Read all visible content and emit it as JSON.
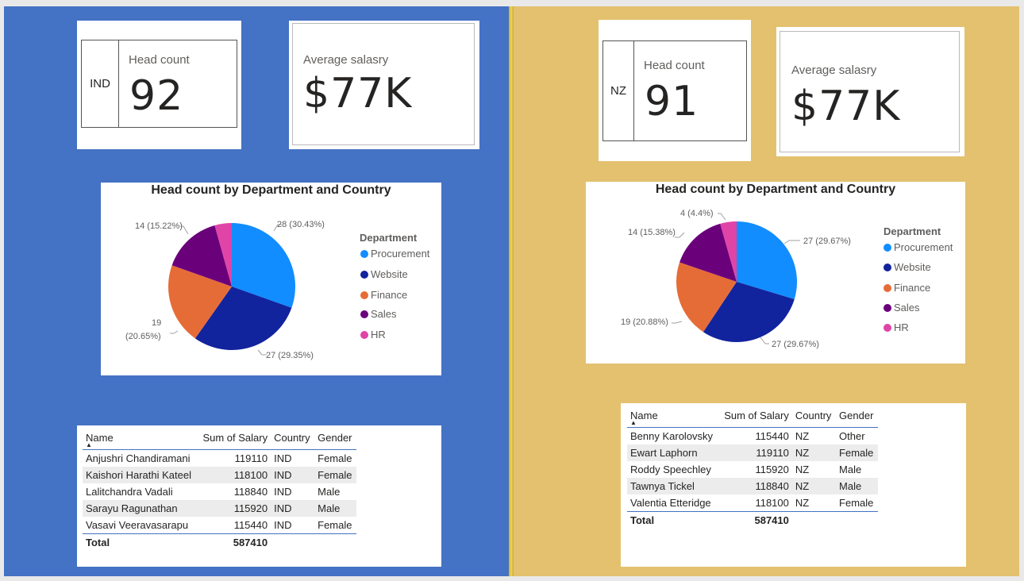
{
  "panels": {
    "ind": {
      "country_code": "IND",
      "head_count_label": "Head count",
      "head_count_value": "92",
      "avg_salary_label": "Average salasry",
      "avg_salary_value": "$77K",
      "chart": {
        "title": "Head count by Department and Country",
        "legend_title": "Department",
        "legend": [
          "Procurement",
          "Website",
          "Finance",
          "Sales",
          "HR"
        ],
        "slice_labels": [
          "28 (30.43%)",
          "27 (29.35%)",
          "19",
          "(20.65%)",
          "14 (15.22%)"
        ]
      },
      "table": {
        "headers": [
          "Name",
          "Sum of Salary",
          "Country",
          "Gender"
        ],
        "rows": [
          [
            "Anjushri Chandiramani",
            "119110",
            "IND",
            "Female"
          ],
          [
            "Kaishori Harathi Kateel",
            "118100",
            "IND",
            "Female"
          ],
          [
            "Lalitchandra Vadali",
            "118840",
            "IND",
            "Male"
          ],
          [
            "Sarayu Ragunathan",
            "115920",
            "IND",
            "Male"
          ],
          [
            "Vasavi Veeravasarapu",
            "115440",
            "IND",
            "Female"
          ]
        ],
        "total_label": "Total",
        "total_value": "587410"
      }
    },
    "nz": {
      "country_code": "NZ",
      "head_count_label": "Head count",
      "head_count_value": "91",
      "avg_salary_label": "Average salasry",
      "avg_salary_value": "$77K",
      "chart": {
        "title": "Head count by Department and Country",
        "legend_title": "Department",
        "legend": [
          "Procurement",
          "Website",
          "Finance",
          "Sales",
          "HR"
        ],
        "slice_labels": [
          "27 (29.67%)",
          "27 (29.67%)",
          "19 (20.88%)",
          "14 (15.38%)",
          "4 (4.4%)"
        ]
      },
      "table": {
        "headers": [
          "Name",
          "Sum of Salary",
          "Country",
          "Gender"
        ],
        "rows": [
          [
            "Benny Karolovsky",
            "115440",
            "NZ",
            "Other"
          ],
          [
            "Ewart Laphorn",
            "119110",
            "NZ",
            "Female"
          ],
          [
            "Roddy Speechley",
            "115920",
            "NZ",
            "Male"
          ],
          [
            "Tawnya Tickel",
            "118840",
            "NZ",
            "Male"
          ],
          [
            "Valentia Etteridge",
            "118100",
            "NZ",
            "Female"
          ]
        ],
        "total_label": "Total",
        "total_value": "587410"
      }
    }
  },
  "colors": {
    "left_background": "#4472c4",
    "right_background": "#e3c16f",
    "procurement": "#118dff",
    "website": "#12239e",
    "finance": "#e66c37",
    "sales": "#6b007b",
    "hr": "#e044a7"
  },
  "chart_data": [
    {
      "type": "pie",
      "title": "Head count by Department and Country",
      "legend_title": "Department",
      "categories": [
        "Procurement",
        "Website",
        "Finance",
        "Sales",
        "HR"
      ],
      "values": [
        28,
        27,
        19,
        14,
        4
      ],
      "percent": [
        30.43,
        29.35,
        20.65,
        15.22,
        null
      ]
    },
    {
      "type": "pie",
      "title": "Head count by Department and Country",
      "legend_title": "Department",
      "categories": [
        "Procurement",
        "Website",
        "Finance",
        "Sales",
        "HR"
      ],
      "values": [
        27,
        27,
        19,
        14,
        4
      ],
      "percent": [
        29.67,
        29.67,
        20.88,
        15.38,
        4.4
      ]
    }
  ]
}
